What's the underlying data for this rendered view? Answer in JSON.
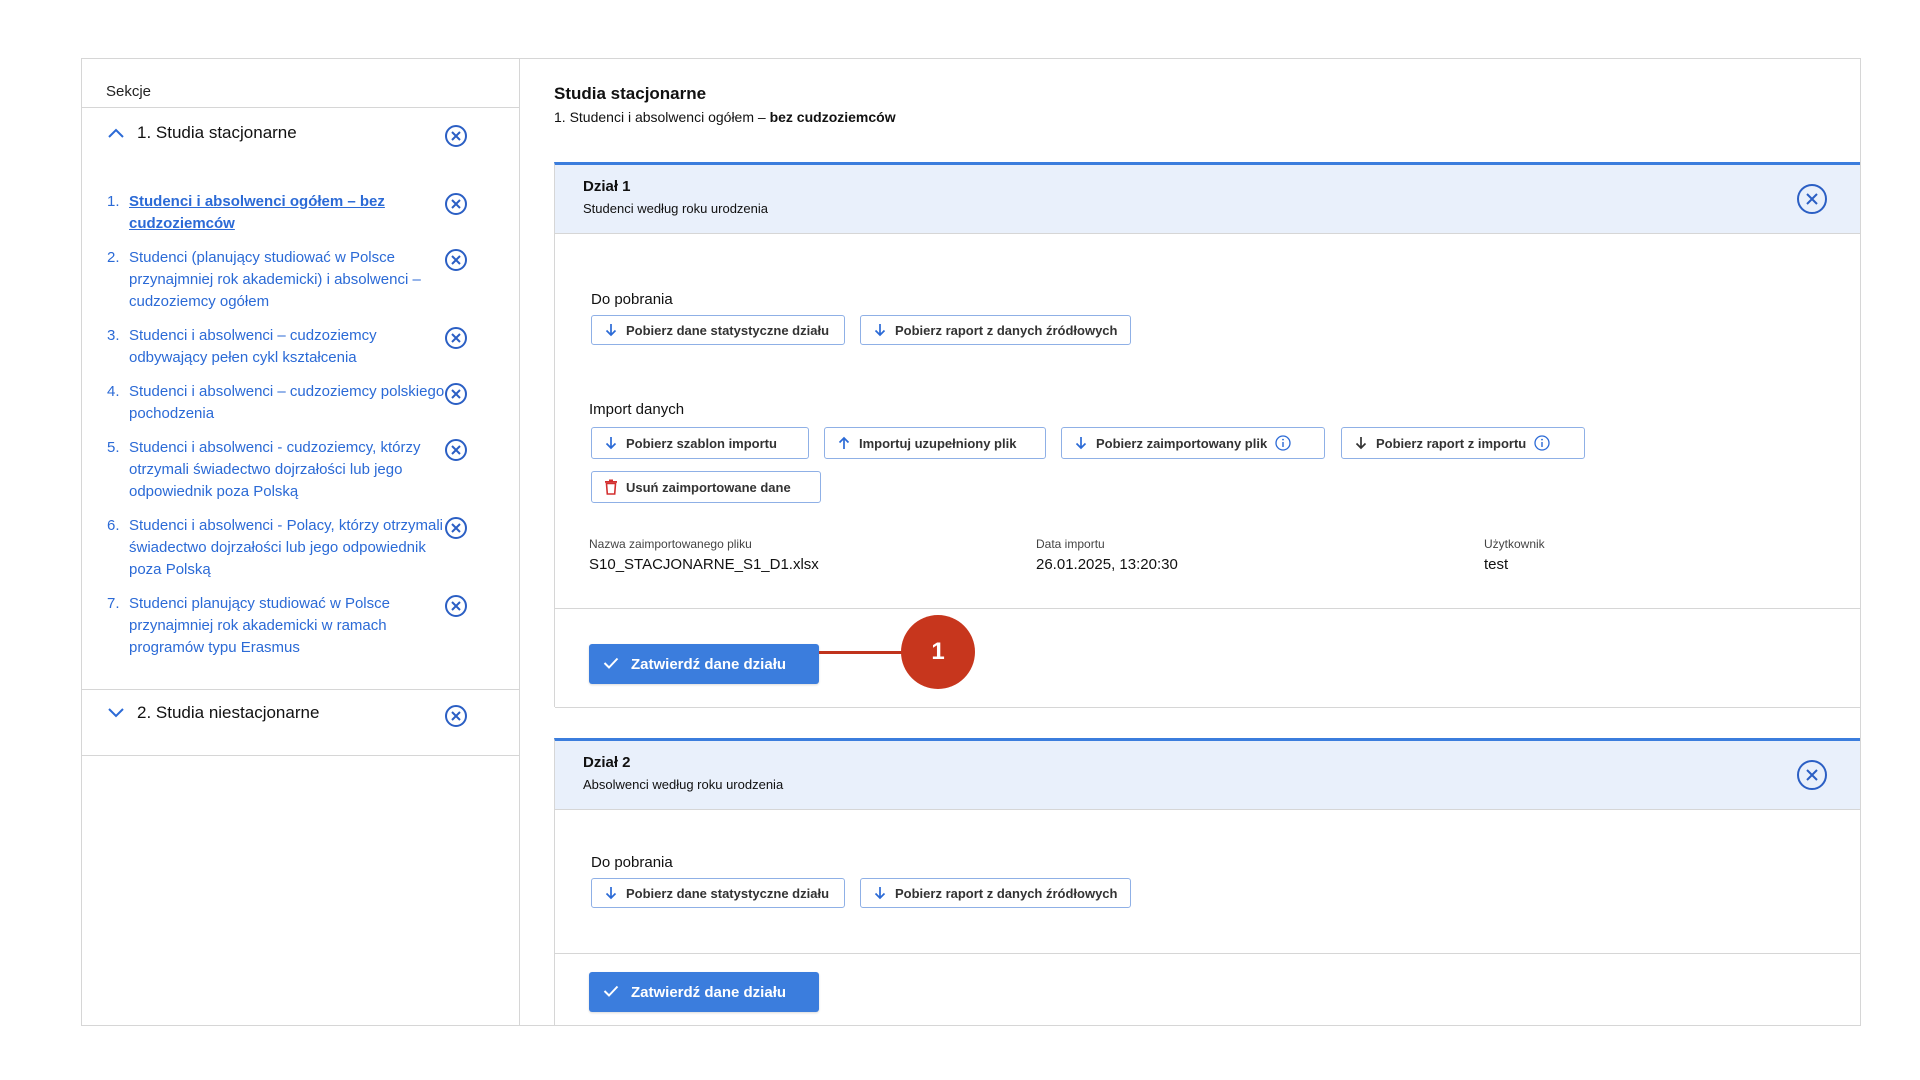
{
  "sidebar": {
    "title": "Sekcje",
    "sections": [
      {
        "label": "1. Studia stacjonarne",
        "expanded": true
      },
      {
        "label": "2. Studia niestacjonarne",
        "expanded": false
      }
    ],
    "items": [
      {
        "num": "1.",
        "label": "Studenci i absolwenci ogółem – bez cudzoziemców",
        "active": true
      },
      {
        "num": "2.",
        "label": "Studenci (planujący studiować w Polsce przynajmniej rok akademicki) i absolwenci – cudzoziemcy ogółem"
      },
      {
        "num": "3.",
        "label": "Studenci i absolwenci – cudzoziemcy odbywający pełen cykl kształcenia"
      },
      {
        "num": "4.",
        "label": "Studenci i absolwenci – cudzoziemcy polskiego pochodzenia"
      },
      {
        "num": "5.",
        "label": "Studenci i absolwenci - cudzoziemcy, którzy otrzymali świadectwo dojrzałości lub jego odpowiednik poza Polską"
      },
      {
        "num": "6.",
        "label": "Studenci i absolwenci - Polacy, którzy otrzymali świadectwo dojrzałości lub jego odpowiednik poza Polską"
      },
      {
        "num": "7.",
        "label": "Studenci planujący studiować w Polsce przynajmniej rok akademicki w ramach programów typu Erasmus"
      }
    ]
  },
  "main": {
    "title": "Studia stacjonarne",
    "subtitle_prefix": "1. Studenci i absolwenci ogółem – ",
    "subtitle_bold": "bez cudzoziemców"
  },
  "dzial1": {
    "title": "Dział 1",
    "subtitle": "Studenci według roku urodzenia",
    "download_label": "Do pobrania",
    "btn_stats": "Pobierz dane statystyczne działu",
    "btn_report_source": "Pobierz raport z danych źródłowych",
    "import_label": "Import danych",
    "btn_template": "Pobierz szablon importu",
    "btn_import": "Importuj uzupełniony plik",
    "btn_imported_file": "Pobierz zaimportowany plik",
    "btn_import_report": "Pobierz raport z importu",
    "btn_delete": "Usuń zaimportowane dane",
    "meta": {
      "file_label": "Nazwa zaimportowanego pliku",
      "file_value": "S10_STACJONARNE_S1_D1.xlsx",
      "date_label": "Data importu",
      "date_value": "26.01.2025, 13:20:30",
      "user_label": "Użytkownik",
      "user_value": "test"
    },
    "confirm": "Zatwierdź dane działu"
  },
  "dzial2": {
    "title": "Dział 2",
    "subtitle": "Absolwenci według roku urodzenia",
    "download_label": "Do pobrania",
    "btn_stats": "Pobierz dane statystyczne działu",
    "btn_report_source": "Pobierz raport z danych źródłowych",
    "confirm": "Zatwierdź dane działu"
  },
  "callout": {
    "number": "1"
  },
  "colors": {
    "accent": "#3b7ddd",
    "link": "#2b6ad6",
    "callout": "#c7361d",
    "delete": "#d32f2f"
  }
}
